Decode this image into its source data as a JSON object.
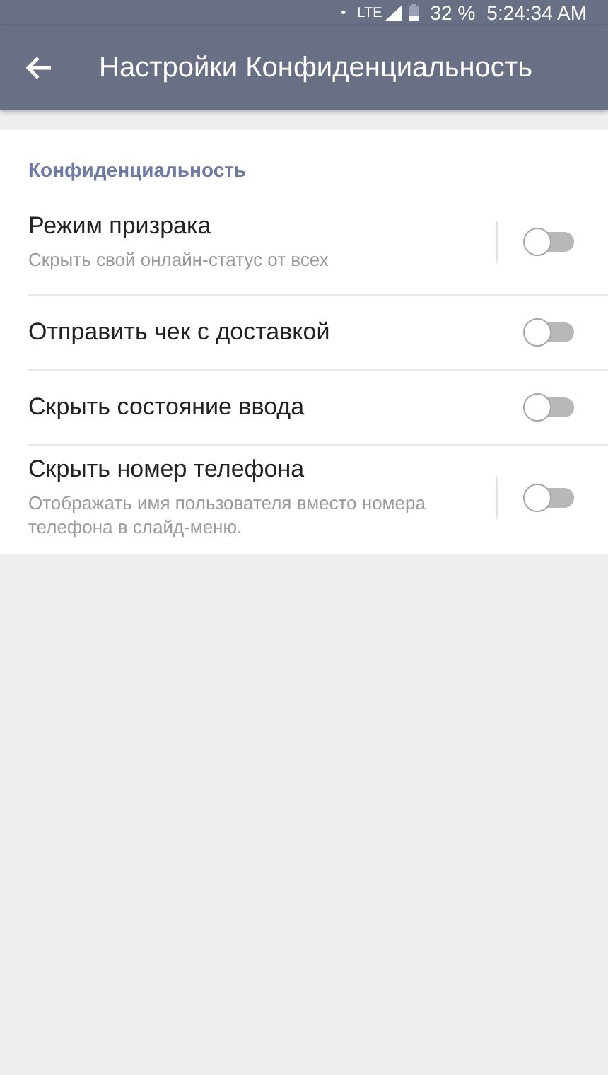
{
  "status_bar": {
    "dot": "•",
    "network": "LTE",
    "battery": "32 %",
    "time": "5:24:34 AM"
  },
  "app_bar": {
    "title": "Настройки Конфиденциальность"
  },
  "section": {
    "title": "Конфиденциальность"
  },
  "settings": [
    {
      "title": "Режим призрака",
      "description": "Скрыть свой онлайн-статус от всех",
      "on": false
    },
    {
      "title": "Отправить чек с доставкой",
      "on": false
    },
    {
      "title": "Скрыть состояние ввода",
      "on": false
    },
    {
      "title": "Скрыть номер телефона",
      "description": "Отображать имя пользователя вместо номера телефона в слайд-меню.",
      "on": false
    }
  ]
}
